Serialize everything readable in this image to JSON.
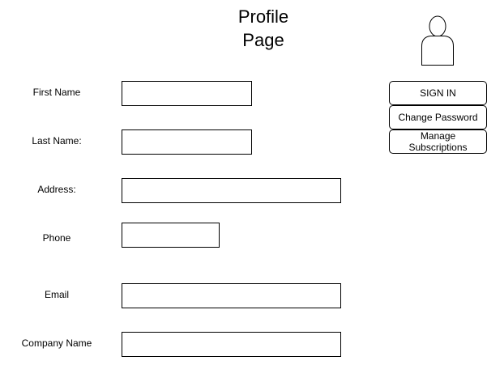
{
  "page": {
    "title_line1": "Profile",
    "title_line2": "Page"
  },
  "avatar": {
    "icon": "user-silhouette-icon"
  },
  "form": {
    "fields": [
      {
        "label": "First Name",
        "value": "",
        "placeholder": ""
      },
      {
        "label": "Last Name:",
        "value": "",
        "placeholder": ""
      },
      {
        "label": "Address:",
        "value": "",
        "placeholder": ""
      },
      {
        "label": "Phone",
        "value": "",
        "placeholder": ""
      },
      {
        "label": "Email",
        "value": "",
        "placeholder": ""
      },
      {
        "label": "Company Name",
        "value": "",
        "placeholder": ""
      }
    ]
  },
  "side_menu": {
    "sign_in": "SIGN IN",
    "change_password": "Change Password",
    "manage_subscriptions": "Manage Subscriptions"
  },
  "colors": {
    "background": "#ffffff",
    "stroke": "#000000",
    "text": "#000000"
  }
}
